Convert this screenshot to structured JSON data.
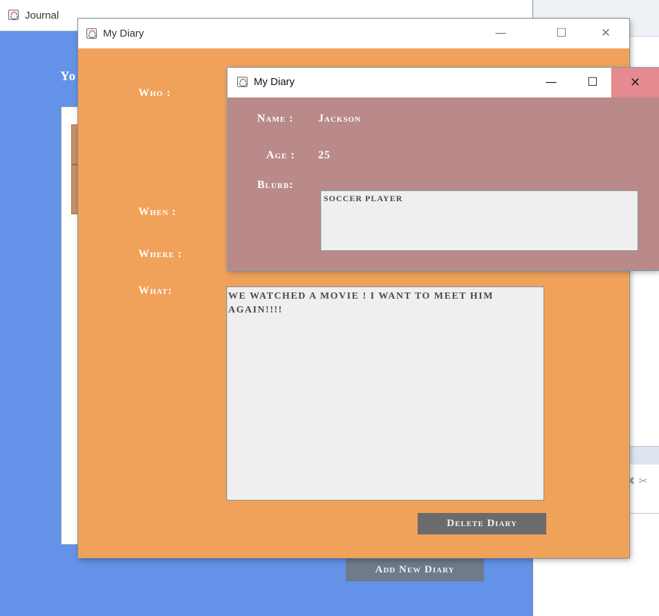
{
  "journal_window": {
    "title": "Journal",
    "heading": "Yo",
    "add_button_label": "Add New Diary"
  },
  "diary_window": {
    "title": "My Diary",
    "labels": {
      "who": "Who :",
      "when": "When :",
      "where": "Where :",
      "what": "What:"
    },
    "what_text": "We watched a movie ! I want to meet him again!!!!",
    "delete_button_label": "Delete Diary",
    "controls": {
      "minimize": "—",
      "maximize": "☐",
      "close": "✕"
    }
  },
  "profile_window": {
    "title": "My Diary",
    "labels": {
      "name": "Name :",
      "age": "Age :",
      "blurb": "Blurb:"
    },
    "name_value": "Jackson",
    "age_value": "25",
    "blurb_text": "soccer player",
    "controls": {
      "minimize": "—",
      "maximize": "☐",
      "close": "✕"
    }
  },
  "background_app": {
    "icons": "✖ ✂"
  },
  "colors": {
    "journal_bg": "#6492e9",
    "diary_bg": "#f0a25a",
    "profile_bg": "#b98a89",
    "button_gray": "#6b6b6b",
    "close_hover": "#e58a8e"
  }
}
